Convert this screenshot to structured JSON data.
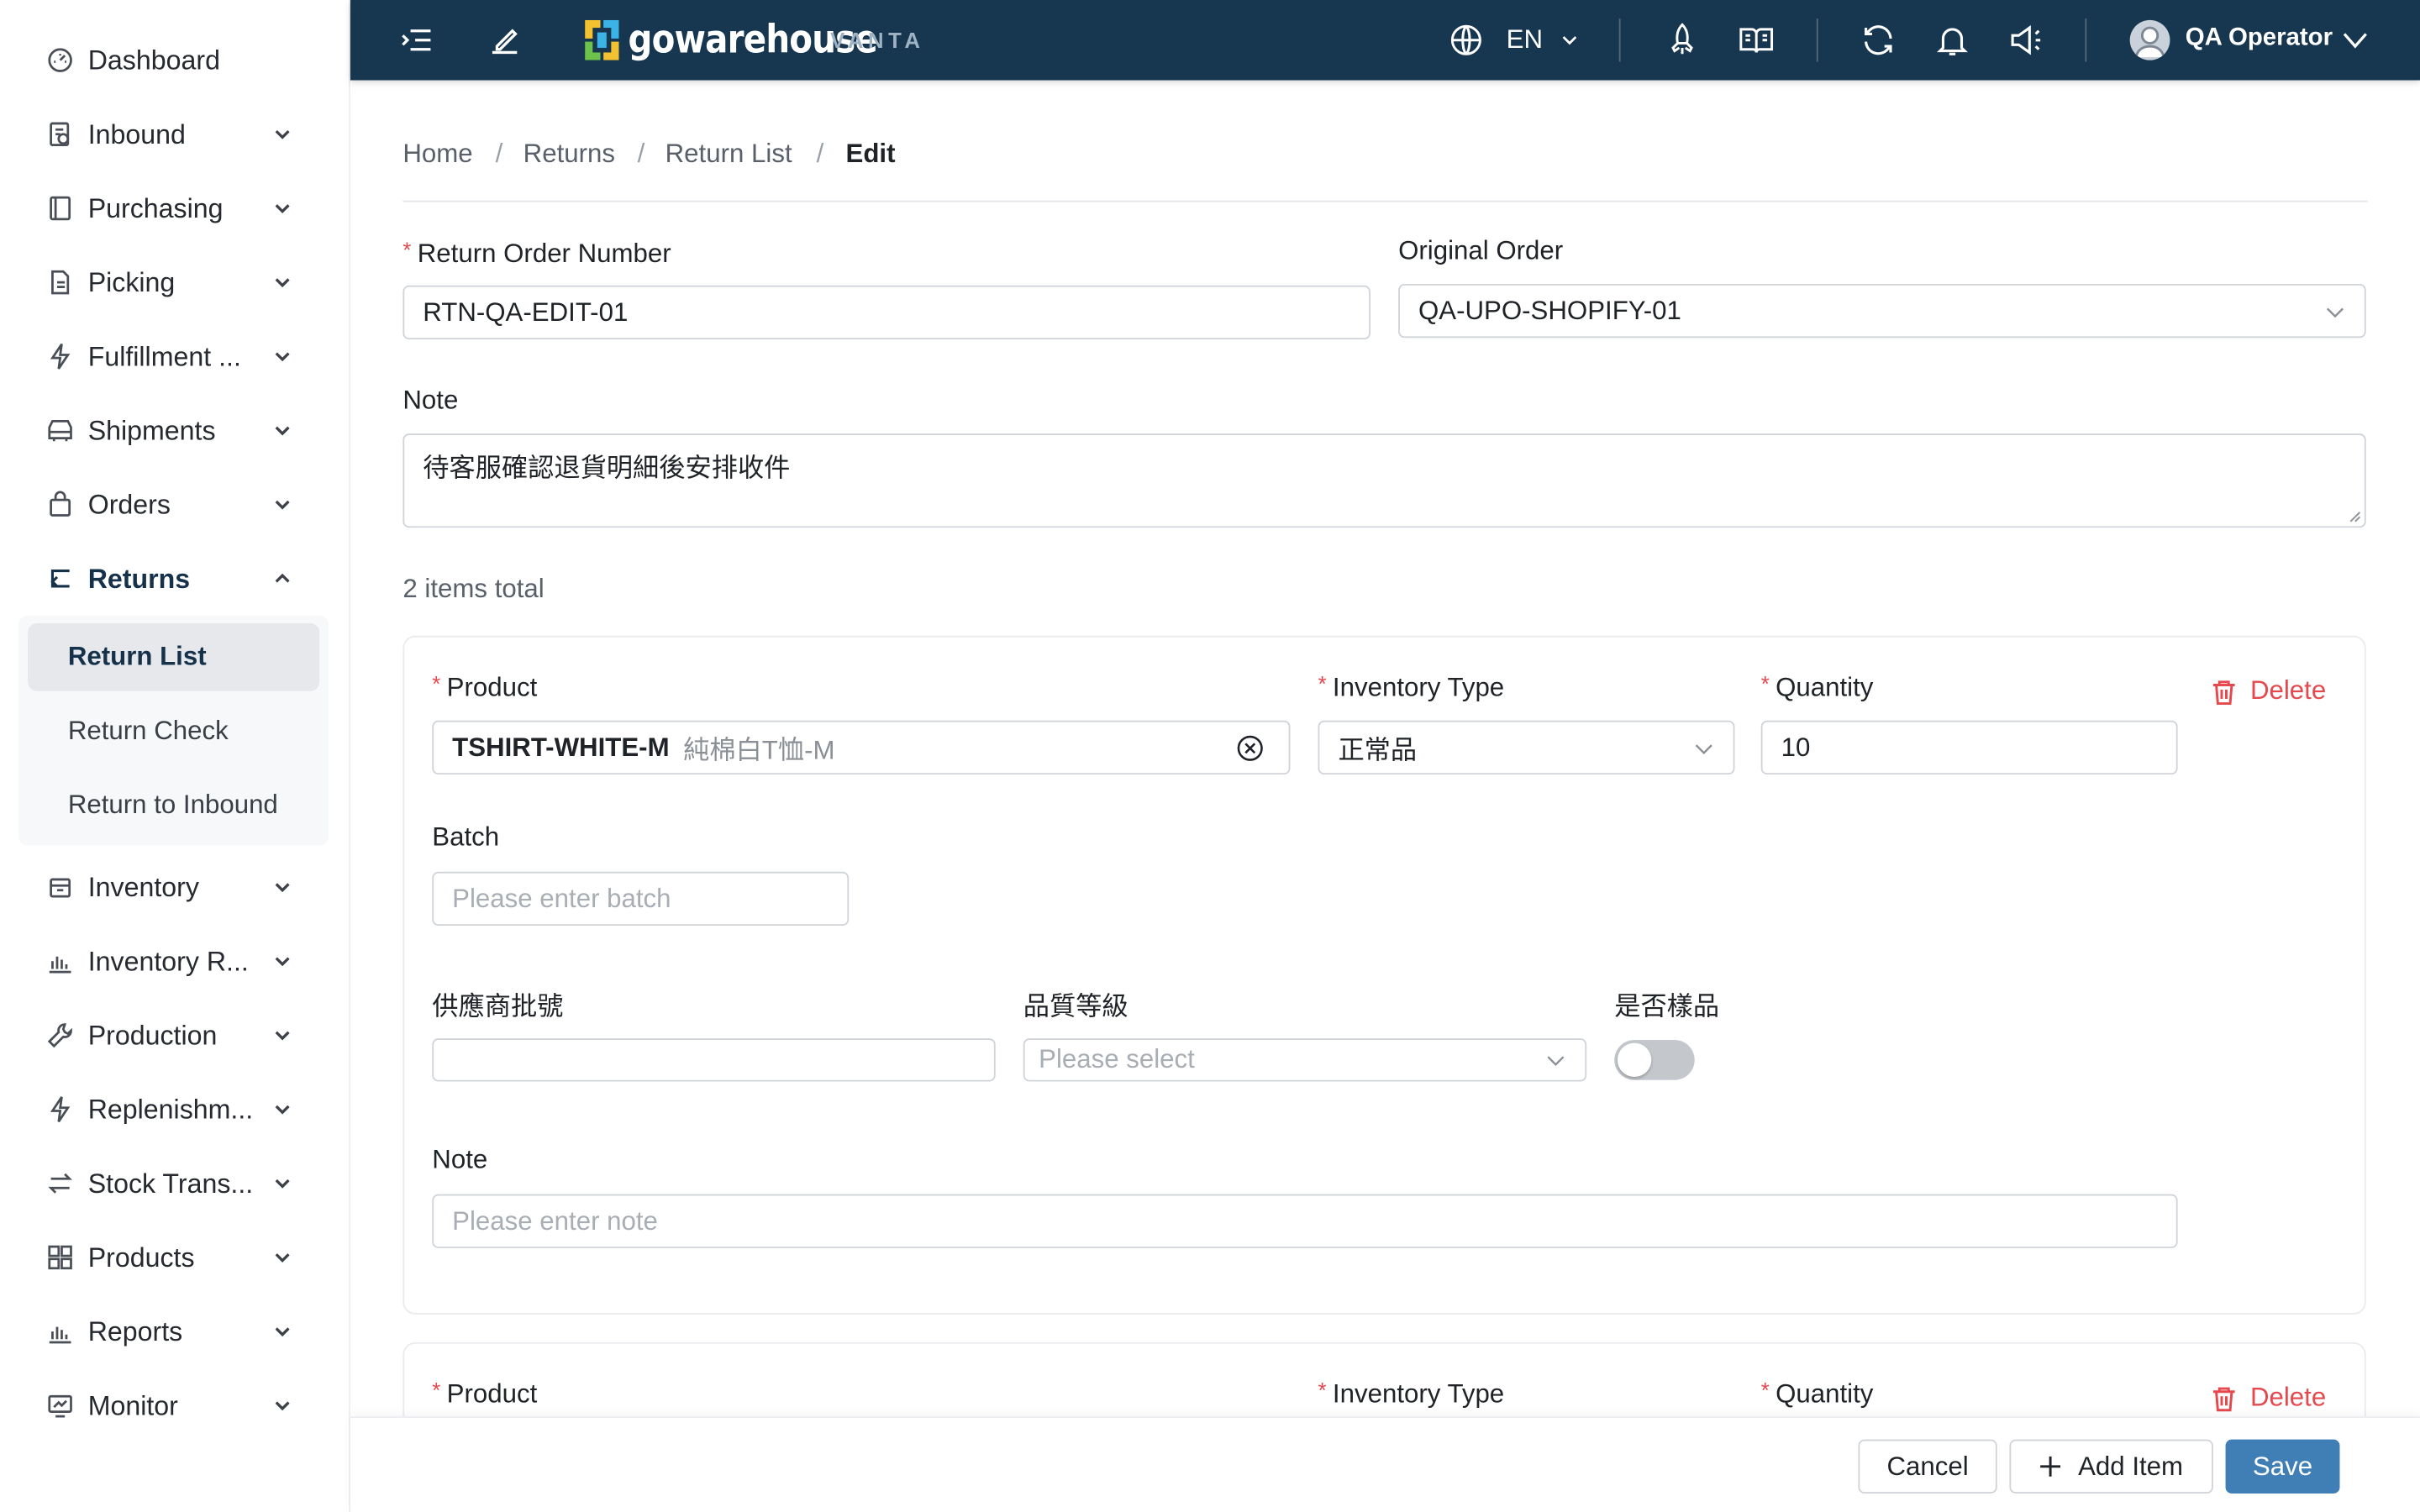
{
  "topbar": {
    "logo_text": "gowarehouse",
    "logo_sub": "VANTA",
    "language": "EN",
    "user_name": "QA Operator"
  },
  "sidebar": {
    "items": [
      {
        "label": "Dashboard",
        "icon": "dashboard-icon"
      },
      {
        "label": "Inbound",
        "icon": "inbound-icon"
      },
      {
        "label": "Purchasing",
        "icon": "purchasing-icon"
      },
      {
        "label": "Picking",
        "icon": "picking-icon"
      },
      {
        "label": "Fulfillment ...",
        "icon": "bolt-icon"
      },
      {
        "label": "Shipments",
        "icon": "truck-icon"
      },
      {
        "label": "Orders",
        "icon": "bag-icon"
      },
      {
        "label": "Returns",
        "icon": "return-icon"
      },
      {
        "label": "Inventory",
        "icon": "inventory-icon"
      },
      {
        "label": "Inventory R...",
        "icon": "chart-icon"
      },
      {
        "label": "Production",
        "icon": "wrench-icon"
      },
      {
        "label": "Replenishm...",
        "icon": "bolt-icon"
      },
      {
        "label": "Stock Trans...",
        "icon": "transfer-icon"
      },
      {
        "label": "Products",
        "icon": "grid-icon"
      },
      {
        "label": "Reports",
        "icon": "chart-icon"
      },
      {
        "label": "Monitor",
        "icon": "monitor-icon"
      }
    ],
    "returns_submenu": [
      "Return List",
      "Return Check",
      "Return to Inbound"
    ]
  },
  "breadcrumb": [
    "Home",
    "Returns",
    "Return List",
    "Edit"
  ],
  "form": {
    "return_order_number_label": "Return Order Number",
    "return_order_number_value": "RTN-QA-EDIT-01",
    "original_order_label": "Original Order",
    "original_order_value": "QA-UPO-SHOPIFY-01",
    "note_label": "Note",
    "note_value": "待客服確認退貨明細後安排收件",
    "items_total": "2 items total"
  },
  "items": [
    {
      "product_label": "Product",
      "product_sku": "TSHIRT-WHITE-M",
      "product_name": "純棉白T恤-M",
      "inventory_type_label": "Inventory Type",
      "inventory_type_value": "正常品",
      "quantity_label": "Quantity",
      "quantity_value": "10",
      "delete_label": "Delete",
      "batch_label": "Batch",
      "batch_placeholder": "Please enter batch",
      "supplier_batch_label": "供應商批號",
      "quality_grade_label": "品質等級",
      "quality_grade_placeholder": "Please select",
      "is_sample_label": "是否樣品",
      "is_sample": false,
      "note_label": "Note",
      "note_placeholder": "Please enter note"
    },
    {
      "product_label": "Product",
      "inventory_type_label": "Inventory Type",
      "quantity_label": "Quantity",
      "delete_label": "Delete"
    }
  ],
  "footer": {
    "cancel": "Cancel",
    "add_item": "Add Item",
    "save": "Save"
  },
  "colors": {
    "topbar": "#17364f",
    "primary": "#3f7fb5",
    "danger": "#e5484d",
    "required": "#e5484d"
  }
}
